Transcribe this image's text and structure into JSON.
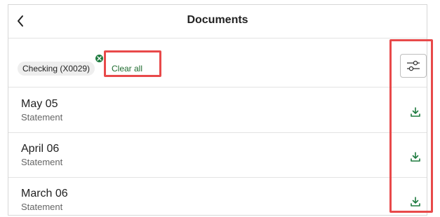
{
  "header": {
    "title": "Documents",
    "back_icon": "chevron-left-icon"
  },
  "filters": {
    "chip_label": "Checking (X0029)",
    "chip_remove_icon": "close-circle-icon",
    "clear_all_label": "Clear all",
    "filter_icon": "sliders-icon"
  },
  "documents": [
    {
      "date": "May 05",
      "type": "Statement",
      "action_icon": "download-icon"
    },
    {
      "date": "April 06",
      "type": "Statement",
      "action_icon": "download-icon"
    },
    {
      "date": "March 06",
      "type": "Statement",
      "action_icon": "download-icon"
    }
  ],
  "colors": {
    "accent_green": "#1e7b3f",
    "annotation_red": "#e8494a"
  }
}
